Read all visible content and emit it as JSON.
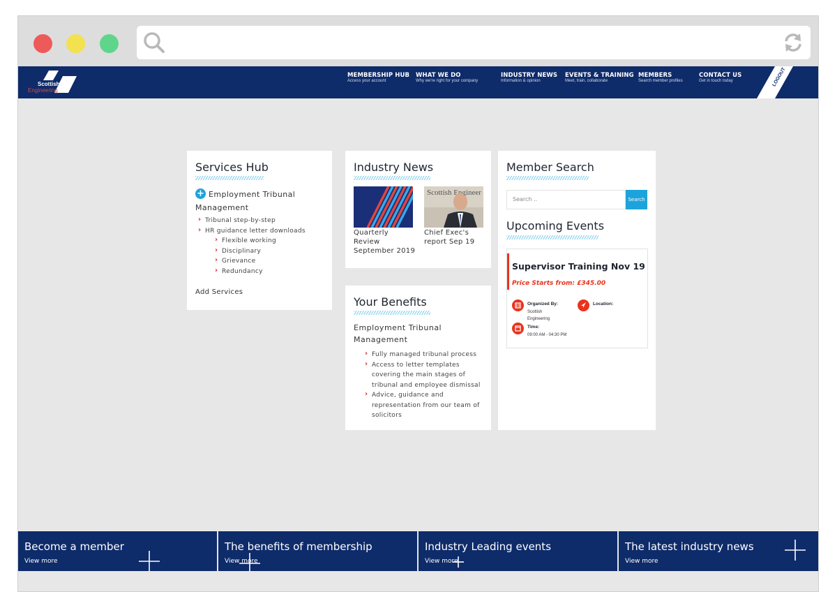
{
  "site": {
    "logo_line1": "Scottish",
    "logo_line2": "Engineering"
  },
  "nav": [
    {
      "title": "MEMBERSHIP HUB",
      "sub": "Access your account"
    },
    {
      "title": "WHAT WE DO",
      "sub": "Why we're right for your company"
    },
    {
      "title": "INDUSTRY NEWS",
      "sub": "Information & opinion"
    },
    {
      "title": "EVENTS & TRAINING",
      "sub": "Meet, train, collaborate"
    },
    {
      "title": "MEMBERS",
      "sub": "Search member profiles"
    },
    {
      "title": "CONTACT US",
      "sub": "Get in touch today"
    }
  ],
  "logout_label": "LOGOUT",
  "services_hub": {
    "title": "Services Hub",
    "heading": "Employment Tribunal Management",
    "items": [
      "Tribunal step-by-step",
      "HR guidance letter downloads"
    ],
    "subitems": [
      "Flexible working",
      "Disciplinary",
      "Grievance",
      "Redundancy"
    ],
    "add_label": "Add Services"
  },
  "industry_news": {
    "title": "Industry News",
    "articles": [
      {
        "caption": "Quarterly Review September 2019",
        "icon": "striped-cover-image"
      },
      {
        "caption": "Chief Exec's report Sep 19",
        "icon": "portrait-photo",
        "photo_text": "Scottish Engineer"
      }
    ]
  },
  "your_benefits": {
    "title": "Your Benefits",
    "heading": "Employment Tribunal Management",
    "items": [
      "Fully managed tribunal process",
      "Access to letter templates covering the main stages of tribunal and employee dismissal",
      "Advice, guidance and representation from our team of solicitors"
    ]
  },
  "member_search": {
    "title": "Member Search",
    "placeholder": "Search ..",
    "button": "Search"
  },
  "upcoming_events": {
    "title": "Upcoming Events",
    "event": {
      "title": "Supervisor Training Nov 19",
      "price": "Price Starts from: £345.00",
      "organized_label": "Organized By:",
      "organized_value": "Scottish Engineering",
      "location_label": "Location:",
      "time_label": "Time:",
      "time_value": "09:00 AM - 04:30 PM"
    }
  },
  "footer_tiles": [
    {
      "title": "Become a member",
      "sub": "View more"
    },
    {
      "title": "The benefits of membership",
      "sub": "View more"
    },
    {
      "title": "Industry Leading events",
      "sub": "View more"
    },
    {
      "title": "The latest industry news",
      "sub": "View more"
    }
  ],
  "colors": {
    "navy": "#0e2b6a",
    "accent_blue": "#1da3dc",
    "accent_red": "#e8331d"
  }
}
